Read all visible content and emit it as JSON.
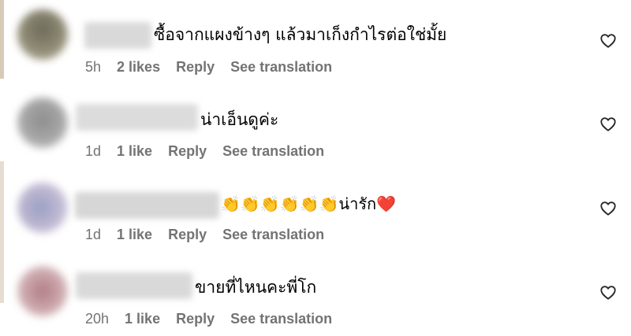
{
  "comments": [
    {
      "text": "ซื้อจากแผงข้างๆ แล้วมาเก็งกำไรต่อใช่มั้ย",
      "time": "5h",
      "likes": "2 likes",
      "reply": "Reply",
      "translate": "See translation"
    },
    {
      "text": "น่าเอ็นดูค่ะ",
      "time": "1d",
      "likes": "1 like",
      "reply": "Reply",
      "translate": "See translation"
    },
    {
      "text": "👏👏👏👏👏👏น่ารัก❤️",
      "time": "1d",
      "likes": "1 like",
      "reply": "Reply",
      "translate": "See translation"
    },
    {
      "text": "ขายที่ไหนคะพี่โก",
      "time": "20h",
      "likes": "1 like",
      "reply": "Reply",
      "translate": "See translation"
    }
  ],
  "icons": {
    "like": "heart-outline-icon"
  },
  "colors": {
    "meta_text": "#737373",
    "heart_stroke": "#262626"
  }
}
